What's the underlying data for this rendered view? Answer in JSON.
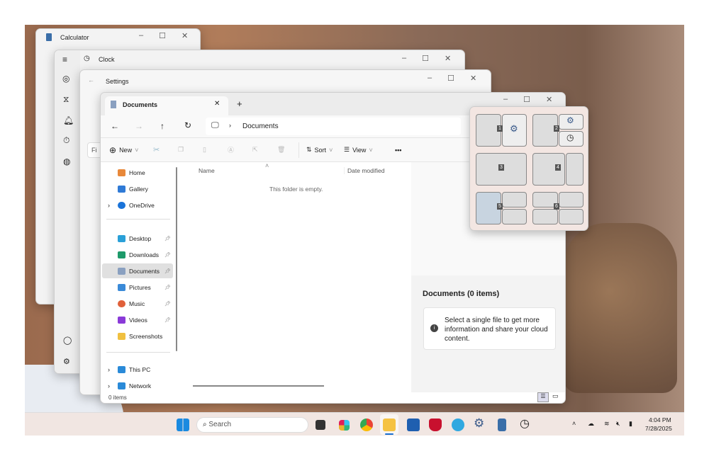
{
  "calculator": {
    "title": "Calculator"
  },
  "clock": {
    "title": "Clock"
  },
  "settings": {
    "title": "Settings",
    "search_placeholder": "Fi"
  },
  "explorer": {
    "tab_title": "Documents",
    "address": "Documents",
    "toolbar": {
      "new": "New",
      "sort": "Sort",
      "view": "View",
      "more": "•••"
    },
    "nav": [
      {
        "label": "Home",
        "color": "#e8883a"
      },
      {
        "label": "Gallery",
        "color": "#2f7ad6"
      },
      {
        "label": "OneDrive",
        "color": "#1a73d9"
      },
      {
        "label": "Desktop",
        "color": "#2aa0d8"
      },
      {
        "label": "Downloads",
        "color": "#1e9a6a"
      },
      {
        "label": "Documents",
        "color": "#8aa0c0"
      },
      {
        "label": "Pictures",
        "color": "#3a8ad8"
      },
      {
        "label": "Music",
        "color": "#e0603a"
      },
      {
        "label": "Videos",
        "color": "#8a3ad8"
      },
      {
        "label": "Screenshots",
        "color": "#f0c040"
      },
      {
        "label": "This PC",
        "color": "#2a8ad8"
      },
      {
        "label": "Network",
        "color": "#2a8ad8"
      }
    ],
    "columns": {
      "name": "Name",
      "date": "Date modified"
    },
    "empty_message": "This folder is empty.",
    "details_title": "Documents (0 items)",
    "details_info": "Select a single file to get more information and share your cloud content.",
    "status": "0 items"
  },
  "snap_layouts": [
    "1",
    "2",
    "3",
    "4",
    "5",
    "6"
  ],
  "taskbar": {
    "search": "Search",
    "time": "4:04 PM",
    "date": "7/28/2025"
  }
}
